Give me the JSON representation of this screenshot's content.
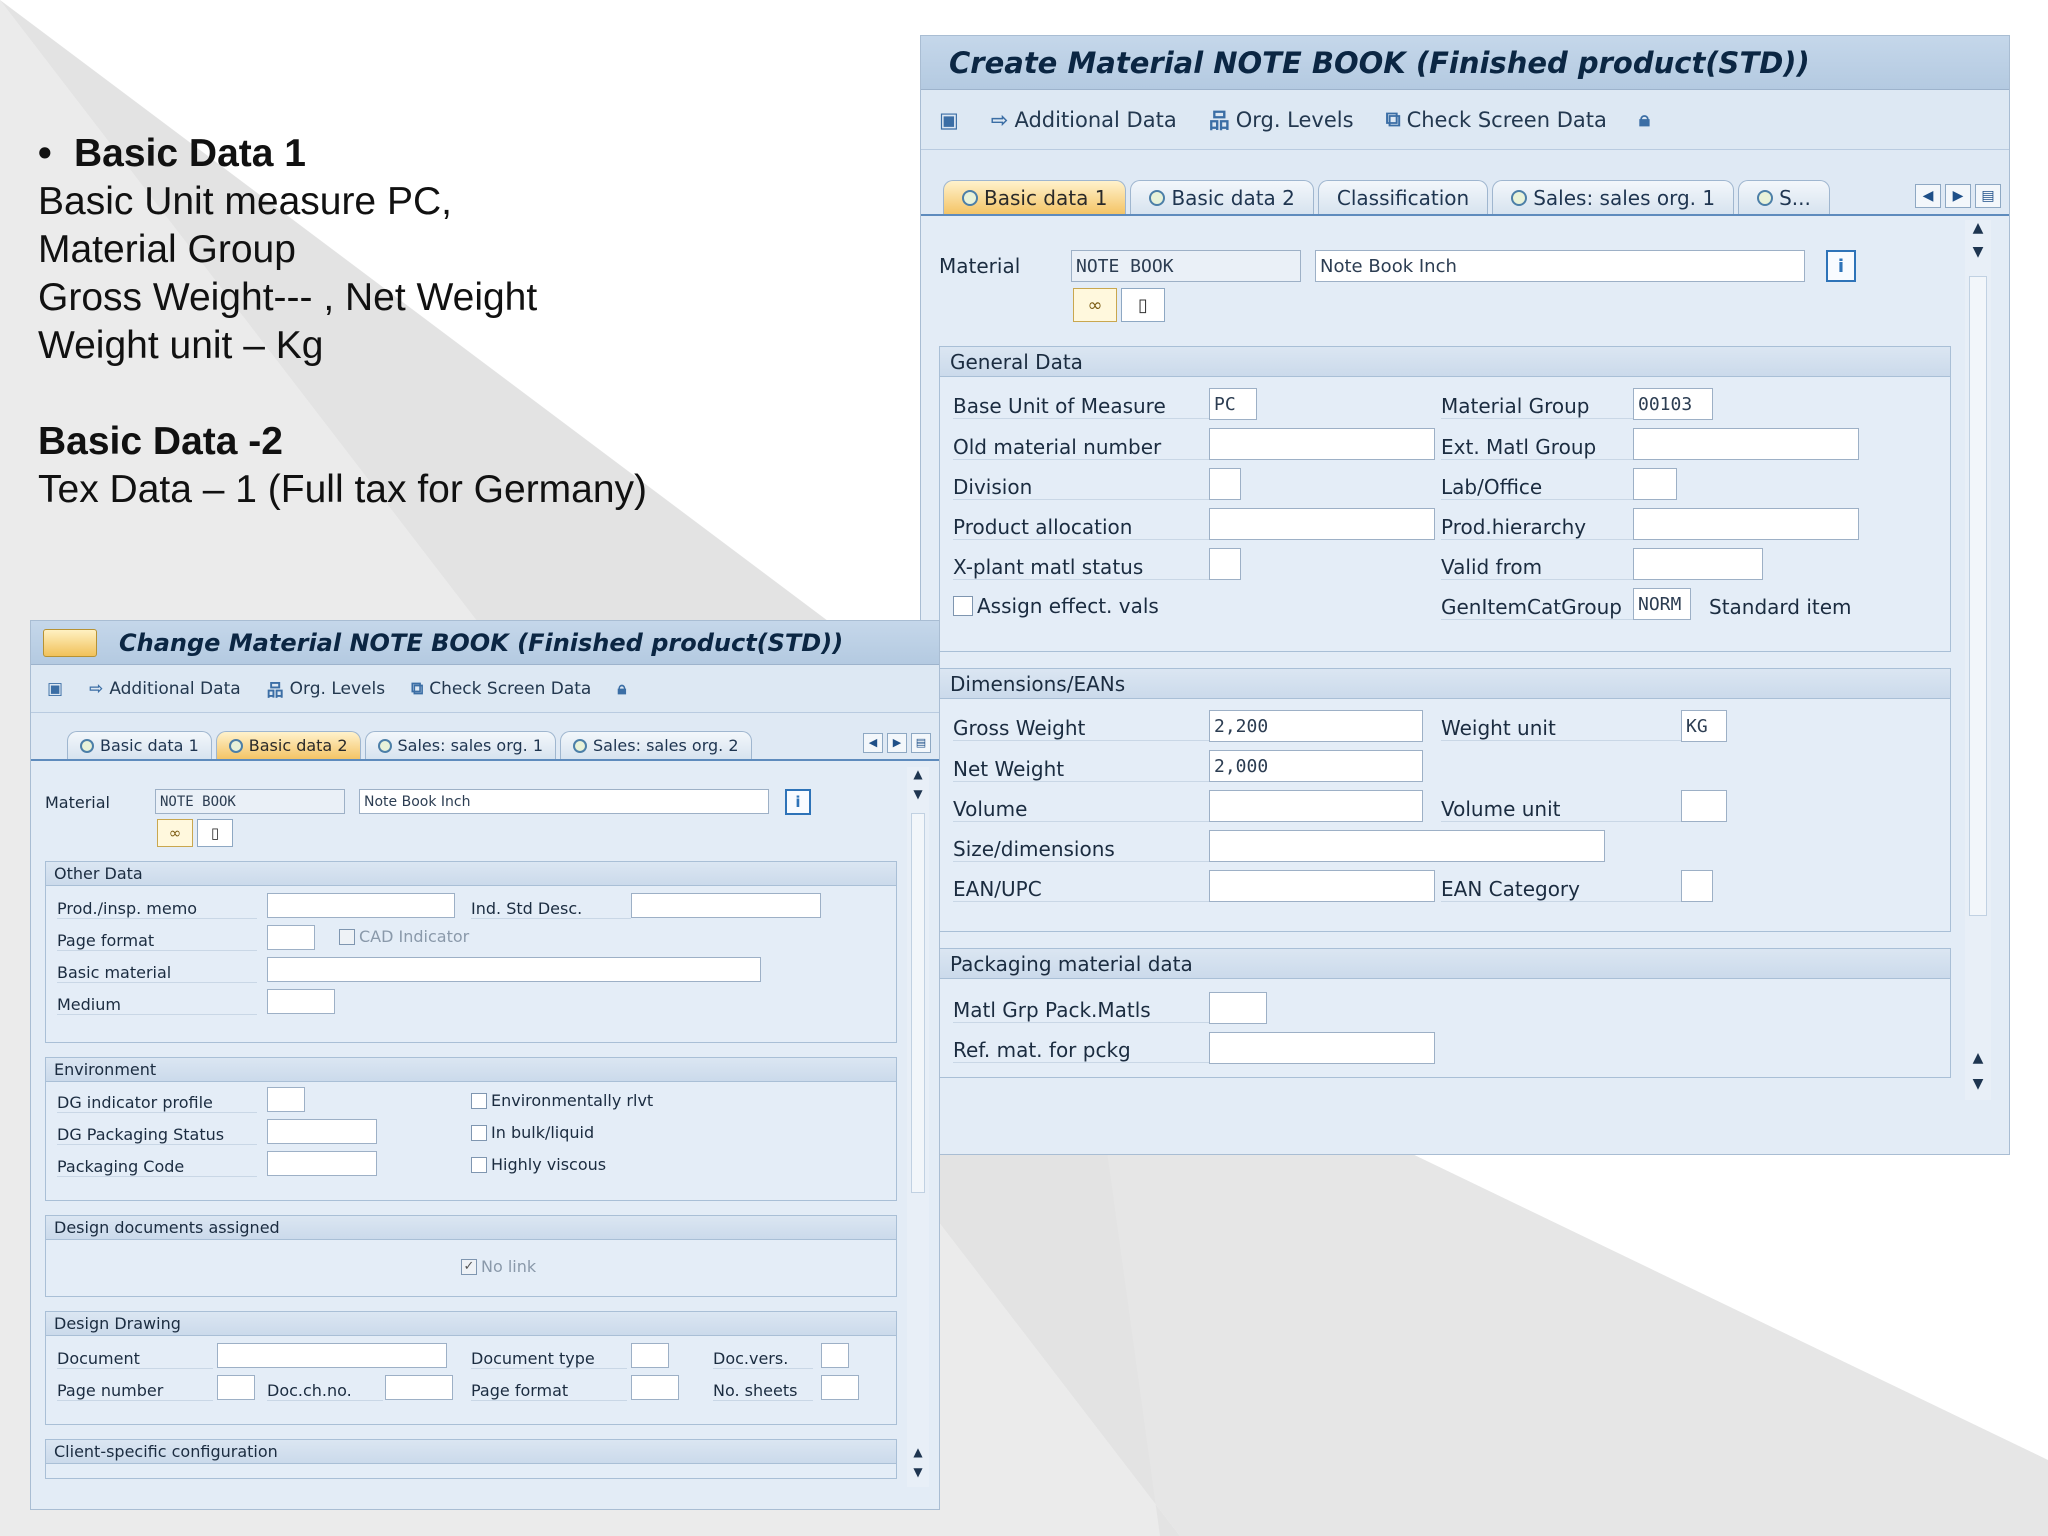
{
  "notes": {
    "heading1": "Basic Data 1",
    "line1": "Basic Unit measure PC,",
    "line2": "Material Group",
    "line3": "Gross Weight--- , Net Weight",
    "line4": "Weight unit – Kg",
    "heading2": "Basic Data -2",
    "line5": "Tex Data – 1 (Full tax for Germany)"
  },
  "toolbar": {
    "additional_data": "Additional Data",
    "org_levels": "Org. Levels",
    "check_screen_data": "Check Screen Data"
  },
  "create_window": {
    "title": "Create Material NOTE BOOK (Finished product(STD))",
    "tabs": [
      {
        "label": "Basic data 1",
        "active": true
      },
      {
        "label": "Basic data 2",
        "active": false
      },
      {
        "label": "Classification",
        "active": false
      },
      {
        "label": "Sales: sales org. 1",
        "active": false
      },
      {
        "label": "S...",
        "active": false
      }
    ],
    "material_label": "Material",
    "material_value": "NOTE BOOK",
    "material_desc": "Note Book Inch",
    "general": {
      "title": "General Data",
      "base_uom_label": "Base Unit of Measure",
      "base_uom_value": "PC",
      "material_group_label": "Material Group",
      "material_group_value": "00103",
      "old_material_label": "Old material number",
      "ext_matl_group_label": "Ext. Matl Group",
      "division_label": "Division",
      "lab_office_label": "Lab/Office",
      "product_allocation_label": "Product allocation",
      "prod_hierarchy_label": "Prod.hierarchy",
      "xplant_status_label": "X-plant matl status",
      "valid_from_label": "Valid from",
      "assign_effect_label": "Assign effect. vals",
      "gen_item_cat_label": "GenItemCatGroup",
      "gen_item_cat_value": "NORM",
      "gen_item_cat_desc": "Standard item"
    },
    "dimensions": {
      "title": "Dimensions/EANs",
      "gross_weight_label": "Gross Weight",
      "gross_weight_value": "2,200",
      "weight_unit_label": "Weight unit",
      "weight_unit_value": "KG",
      "net_weight_label": "Net Weight",
      "net_weight_value": "2,000",
      "volume_label": "Volume",
      "volume_unit_label": "Volume unit",
      "size_label": "Size/dimensions",
      "ean_label": "EAN/UPC",
      "ean_category_label": "EAN Category"
    },
    "packaging": {
      "title": "Packaging material data",
      "matl_grp_label": "Matl Grp Pack.Matls",
      "ref_mat_label": "Ref. mat. for pckg"
    }
  },
  "change_window": {
    "title": "Change Material NOTE BOOK (Finished product(STD))",
    "tabs": [
      {
        "label": "Basic data 1",
        "active": false
      },
      {
        "label": "Basic data 2",
        "active": true
      },
      {
        "label": "Sales: sales org. 1",
        "active": false
      },
      {
        "label": "Sales: sales org. 2",
        "active": false
      }
    ],
    "material_label": "Material",
    "material_value": "NOTE BOOK",
    "material_desc": "Note Book Inch",
    "other": {
      "title": "Other Data",
      "prod_memo_label": "Prod./insp. memo",
      "ind_std_desc_label": "Ind. Std Desc.",
      "page_format_label": "Page format",
      "cad_indicator_label": "CAD Indicator",
      "basic_material_label": "Basic material",
      "medium_label": "Medium"
    },
    "environment": {
      "title": "Environment",
      "dg_indicator_label": "DG indicator profile",
      "env_relevant_label": "Environmentally rlvt",
      "dg_packaging_label": "DG Packaging Status",
      "in_bulk_label": "In bulk/liquid",
      "packaging_code_label": "Packaging Code",
      "highly_viscous_label": "Highly viscous"
    },
    "design_docs": {
      "title": "Design documents assigned",
      "no_link_label": "No link"
    },
    "design_drawing": {
      "title": "Design Drawing",
      "document_label": "Document",
      "document_type_label": "Document type",
      "doc_vers_label": "Doc.vers.",
      "page_number_label": "Page number",
      "doc_ch_no_label": "Doc.ch.no.",
      "page_format_label": "Page format",
      "no_sheets_label": "No. sheets"
    },
    "client_config": {
      "title": "Client-specific configuration"
    }
  }
}
